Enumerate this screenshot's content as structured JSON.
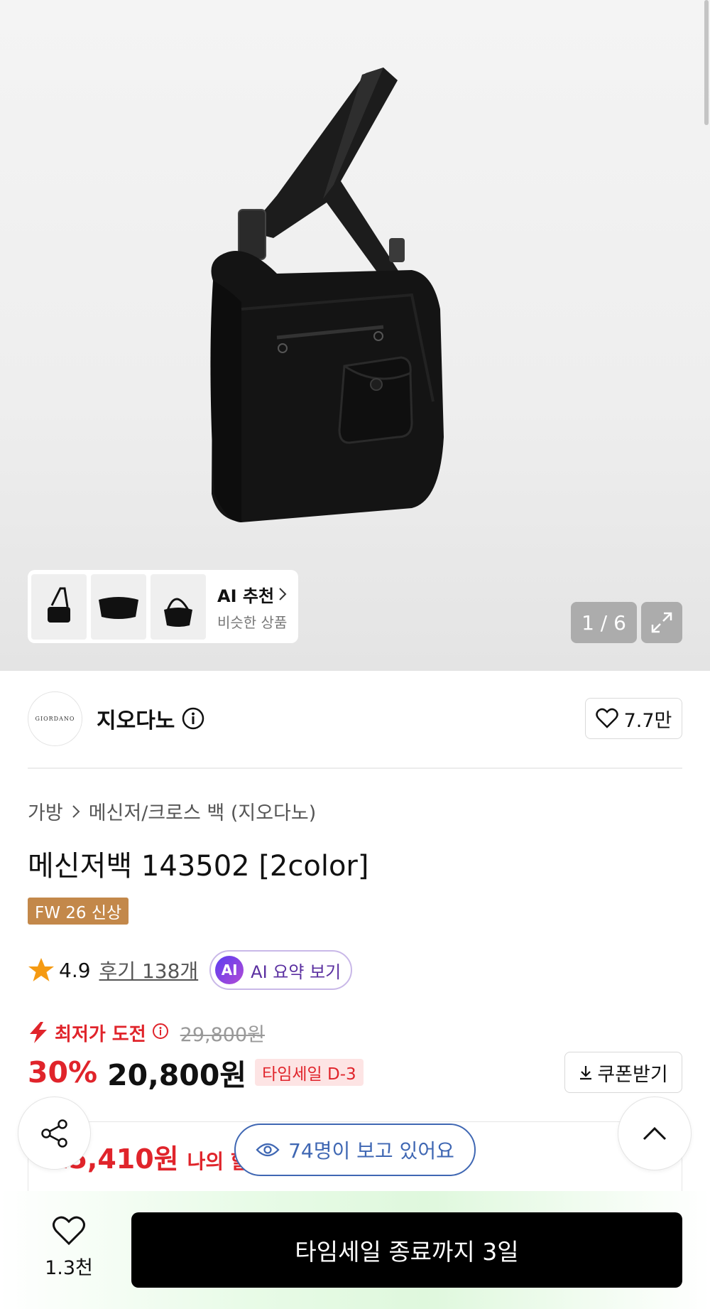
{
  "gallery": {
    "counter": "1 / 6",
    "ai_recommend": {
      "title": "AI 추천",
      "subtitle": "비슷한 상품"
    }
  },
  "brand": {
    "logo_text": "GIORDANO",
    "name": "지오다노",
    "likes": "7.7만"
  },
  "breadcrumb": {
    "level1": "가방",
    "level2": "메신저/크로스 백 (지오다노)"
  },
  "product": {
    "title": "메신저백 143502 [2color]",
    "tag": "FW 26 신상",
    "rating": "4.9",
    "reviews": "후기 138개",
    "ai_summary": "AI 요약 보기",
    "ai_badge": "AI"
  },
  "pricing": {
    "lowest_label": "최저가 도전",
    "original_price": "29,800원",
    "discount": "30%",
    "price": "20,800원",
    "timesale_badge": "타임세일 D-3",
    "coupon_label": "쿠폰받기",
    "my_price": "15,410원",
    "my_price_label": "나의 할"
  },
  "viewers": "74명이 보고 있어요",
  "bottom": {
    "wish_count": "1.3천",
    "buy_label": "타임세일 종료까지 3일"
  },
  "colors": {
    "accent_red": "#e0242b",
    "tag_brown": "#c3884a",
    "viewer_blue": "#3f67b3",
    "ai_purple": "#5a2fa0"
  }
}
